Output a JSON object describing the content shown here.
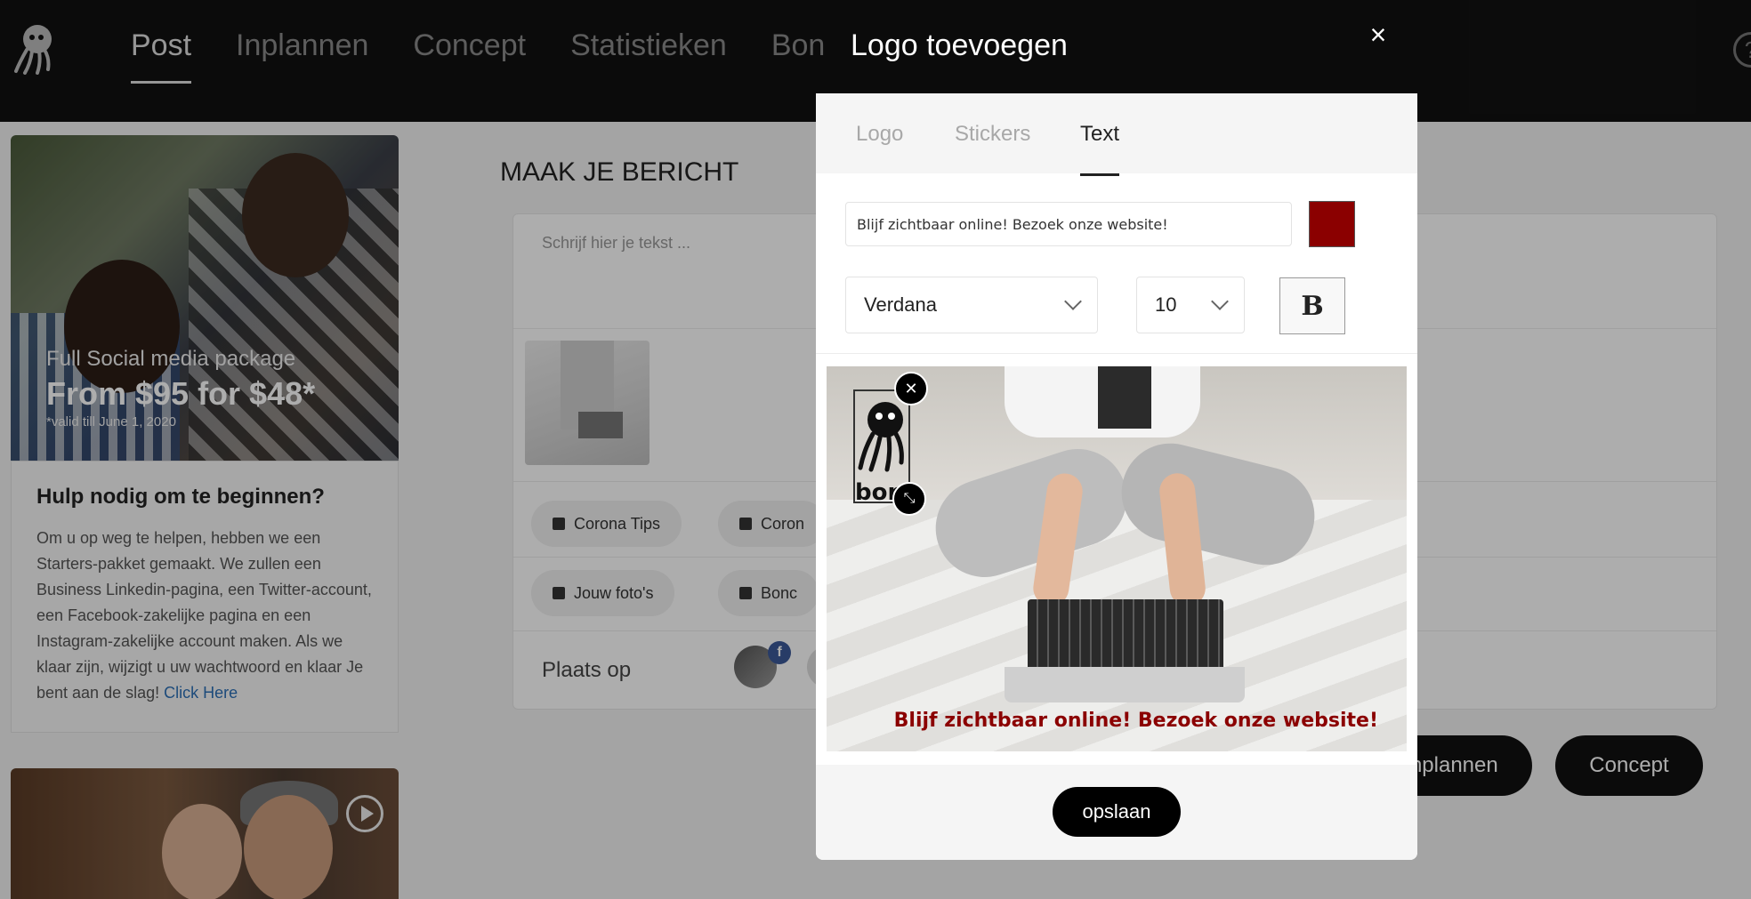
{
  "nav": {
    "items": [
      "Post",
      "Inplannen",
      "Concept",
      "Statistieken",
      "Bon"
    ]
  },
  "promo": {
    "line1": "Full Social media package",
    "line2": "From $95 for $48*",
    "line3": "*valid till June 1, 2020"
  },
  "help": {
    "title": "Hulp nodig om te beginnen?",
    "body": "Om u op weg te helpen, hebben we een Starters-pakket gemaakt. We zullen een Business Linkedin-pagina, een Twitter-account, een Facebook-zakelijke pagina en een Instagram-zakelijke account maken. Als we klaar zijn, wijzigt u uw wachtwoord en klaar Je bent aan de slag!",
    "link": "Click Here"
  },
  "composer": {
    "title": "MAAK JE BERICHT",
    "placeholder": "Schrijf hier je tekst ...",
    "chips": [
      "Corona Tips",
      "Coron",
      "Jouw foto's",
      "Bonc"
    ],
    "place_label": "Plaats op",
    "fb_badge": "f"
  },
  "actions": {
    "schedule": "Inplannen",
    "concept": "Concept"
  },
  "modal": {
    "title": "Logo toevoegen",
    "close": "×",
    "tabs": [
      "Logo",
      "Stickers",
      "Text"
    ],
    "active_tab": "Text",
    "text_value": "Blijf zichtbaar online! Bezoek onze website!",
    "text_color": "#8b0000",
    "font": "Verdana",
    "size": "10",
    "bold_label": "B",
    "preview_text": "Blijf zichtbaar online! Bezoek onze website!",
    "logo_word": "bon",
    "save": "opslaan"
  }
}
